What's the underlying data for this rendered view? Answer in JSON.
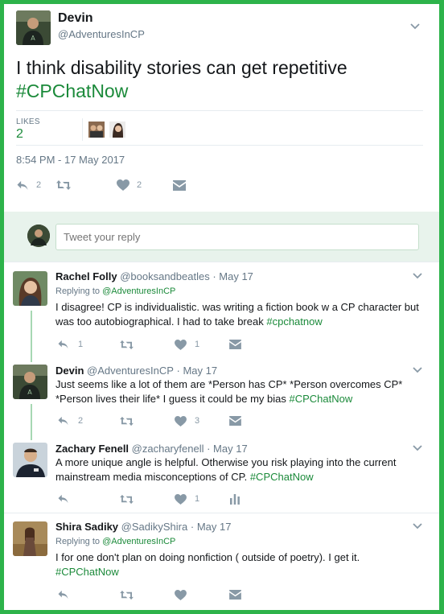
{
  "main_tweet": {
    "name": "Devin",
    "handle": "@AdventuresInCP",
    "text": "I think disability stories can get repetitive",
    "hashtag": "#CPChatNow",
    "likes_label": "LIKES",
    "likes_count": "2",
    "timestamp": "8:54 PM - 17 May 2017",
    "reply_count": "2",
    "like_count": "2"
  },
  "reply_box": {
    "placeholder": "Tweet your reply"
  },
  "replies": [
    {
      "name": "Rachel Folly",
      "handle": "@booksandbeatles",
      "date": "May 17",
      "replying_prefix": "Replying to",
      "replying_to": "@AdventuresInCP",
      "text": "I disagree! CP is individualistic. was writing a fiction book w a CP character but was too autobiographical. I had to take break",
      "hashtag": "#cpchatnow",
      "reply_count": "1",
      "like_count": "1"
    },
    {
      "name": "Devin",
      "handle": "@AdventuresInCP",
      "date": "May 17",
      "text": "Just seems like a lot of them are *Person has CP* *Person overcomes CP* *Person lives their life* I guess it could be my bias",
      "hashtag": "#CPChatNow",
      "reply_count": "2",
      "like_count": "3"
    },
    {
      "name": "Zachary Fenell",
      "handle": "@zacharyfenell",
      "date": "May 17",
      "text": "A more unique angle is helpful. Otherwise you risk playing into the current mainstream media misconceptions of CP.",
      "hashtag": "#CPChatNow",
      "like_count": "1"
    },
    {
      "name": "Shira Sadiky",
      "handle": "@SadikyShira",
      "date": "May 17",
      "replying_prefix": "Replying to",
      "replying_to": "@AdventuresInCP",
      "text": "I for one don't plan on doing nonfiction ( outside of poetry). I get it.",
      "hashtag": "#CPChatNow"
    }
  ],
  "colors": {
    "accent": "#1b8a3a",
    "frame": "#2db34a",
    "icon": "#8899a6"
  }
}
